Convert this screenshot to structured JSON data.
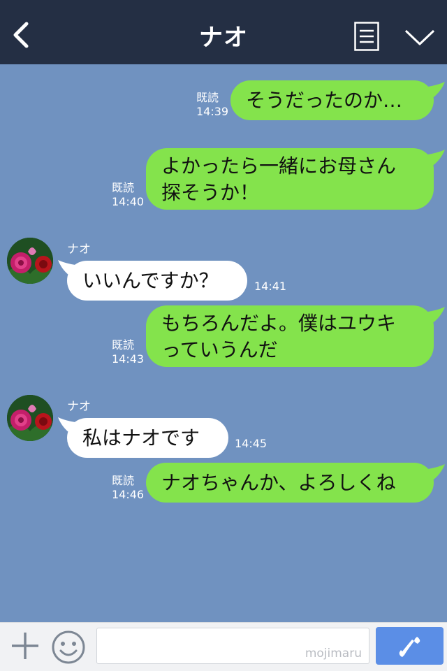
{
  "header": {
    "title": "ナオ",
    "back_icon": "chevron-left-icon",
    "menu_icon": "list-icon",
    "collapse_icon": "chevron-down-icon"
  },
  "contact": {
    "name": "ナオ",
    "avatar": "rose-avatar"
  },
  "messages": [
    {
      "side": "sent",
      "lines": [
        "そうだったのか…"
      ],
      "read": "既読",
      "time": "14:39"
    },
    {
      "side": "sent",
      "lines": [
        "よかったら一緒にお母さん",
        "探そうか！"
      ],
      "read": "既読",
      "time": "14:40"
    },
    {
      "side": "received",
      "sender": "ナオ",
      "lines": [
        "いいんですか？"
      ],
      "time": "14:41"
    },
    {
      "side": "sent",
      "lines": [
        "もちろんだよ。僕はユウキ",
        "っていうんだ"
      ],
      "read": "既読",
      "time": "14:43"
    },
    {
      "side": "received",
      "sender": "ナオ",
      "lines": [
        "私はナオです"
      ],
      "time": "14:45"
    },
    {
      "side": "sent",
      "lines": [
        "ナオちゃんか、よろしくね"
      ],
      "read": "既読",
      "time": "14:46"
    }
  ],
  "footer": {
    "input_value": "",
    "watermark": "mojimaru",
    "add_icon": "plus-icon",
    "emoji_icon": "smiley-icon",
    "call_icon": "phone-icon"
  },
  "colors": {
    "header_bg": "#242f44",
    "chat_bg": "#7092c0",
    "sent_bubble": "#84e34c",
    "received_bubble": "#ffffff",
    "call_button": "#5b8ee6"
  }
}
